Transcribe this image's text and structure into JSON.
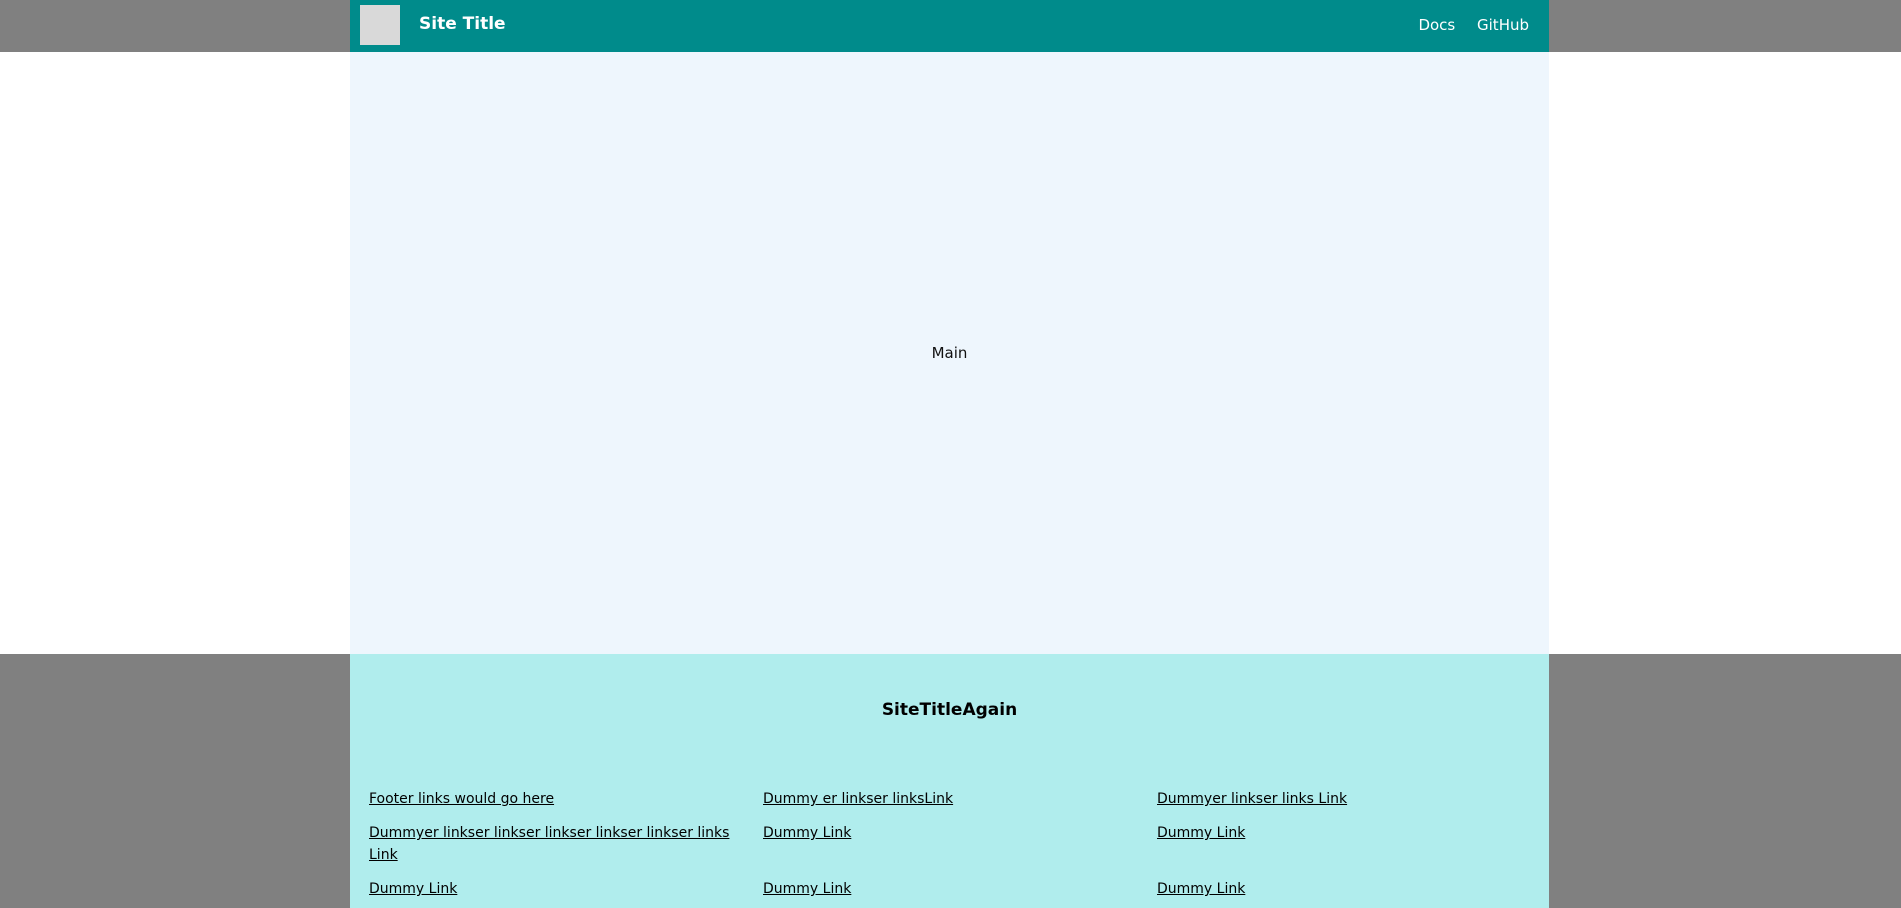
{
  "header": {
    "title": "Site Title",
    "nav": [
      "Docs",
      "GitHub"
    ]
  },
  "main": {
    "text": "Main"
  },
  "footer": {
    "title": "SiteTitleAgain",
    "links": [
      "Footer links would go here",
      "Dummy er linkser linksLink",
      "Dummyer linkser links Link",
      "Dummyer linkser linkser linkser linkser linkser links Link",
      "Dummy Link",
      "Dummy Link",
      "Dummy Link",
      "Dummy Link",
      "Dummy Link"
    ]
  },
  "colors": {
    "header_bg": "#008b8b",
    "main_bg": "#eef6fd",
    "footer_bg": "#b0eded",
    "band_bg": "#808080"
  }
}
